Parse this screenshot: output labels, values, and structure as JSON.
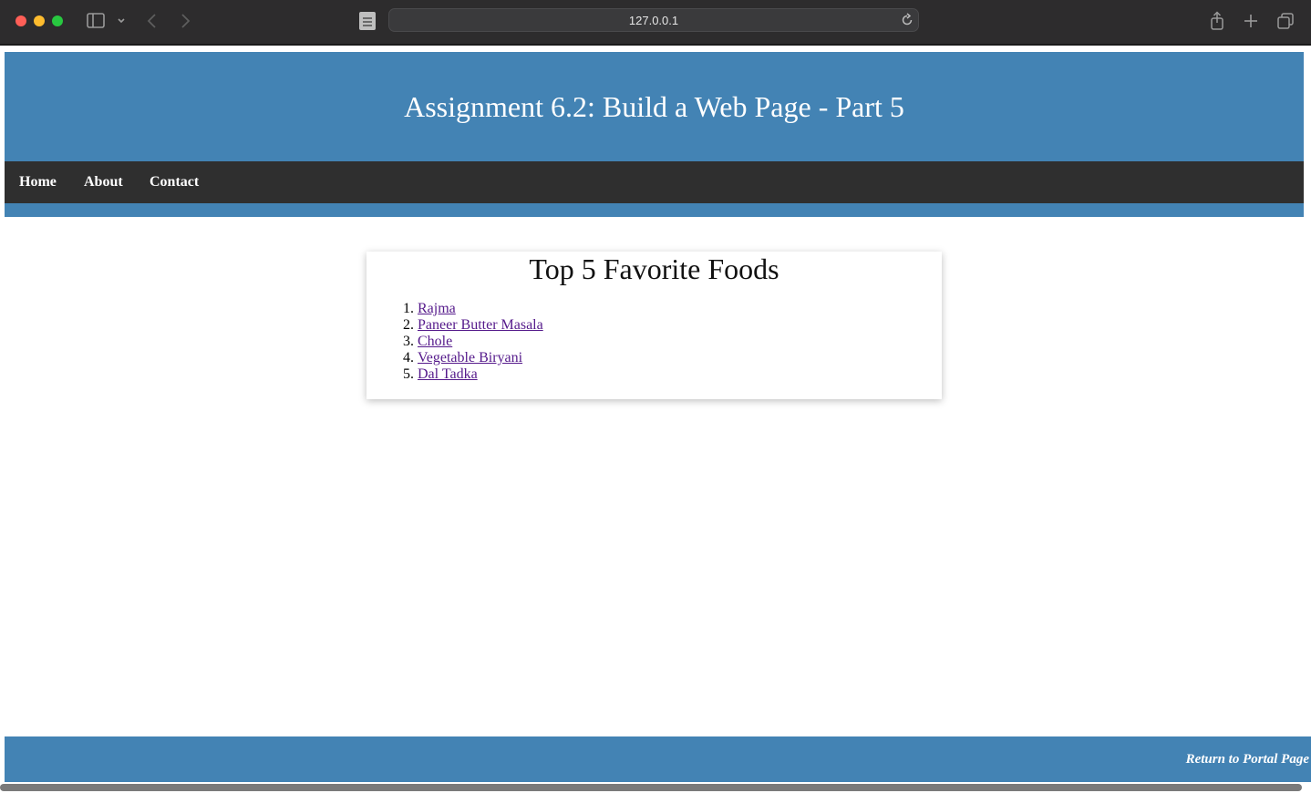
{
  "browser": {
    "url": "127.0.0.1",
    "icons": [
      "sidebar-icon",
      "chevron-down-icon",
      "back-icon",
      "forward-icon",
      "reload-icon",
      "share-icon",
      "new-tab-icon",
      "tabs-overview-icon"
    ]
  },
  "header": {
    "title": "Assignment 6.2: Build a Web Page - Part 5",
    "background_color": "#4383b4"
  },
  "nav": {
    "background_color": "#2f2f2f",
    "items": [
      {
        "label": "Home"
      },
      {
        "label": "About"
      },
      {
        "label": "Contact"
      }
    ]
  },
  "main": {
    "title": "Top 5 Favorite Foods",
    "foods": [
      {
        "label": "Rajma"
      },
      {
        "label": "Paneer Butter Masala"
      },
      {
        "label": "Chole"
      },
      {
        "label": "Vegetable Biryani"
      },
      {
        "label": "Dal Tadka"
      }
    ],
    "link_color": "#551a8b"
  },
  "footer": {
    "link_label": "Return to Portal Page",
    "background_color": "#4383b4"
  }
}
